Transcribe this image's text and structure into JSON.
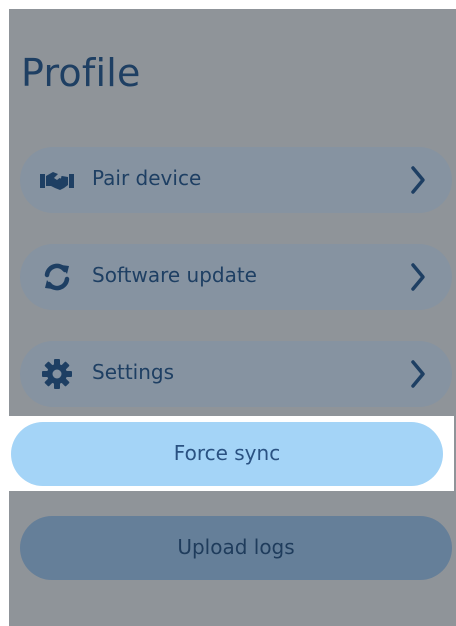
{
  "header": {
    "title": "Profile"
  },
  "menu": {
    "items": [
      {
        "label": "Pair device",
        "icon": "handshake-icon"
      },
      {
        "label": "Software update",
        "icon": "refresh-icon"
      },
      {
        "label": "Settings",
        "icon": "gear-icon"
      }
    ]
  },
  "actions": {
    "force_sync_label": "Force sync",
    "upload_logs_label": "Upload logs"
  },
  "colors": {
    "primary_text": "#1e3f63",
    "menu_bg": "#8693a1",
    "highlight_button": "#a4d4f7",
    "secondary_button": "#657f99",
    "overlay_bg": "#8f9499"
  }
}
